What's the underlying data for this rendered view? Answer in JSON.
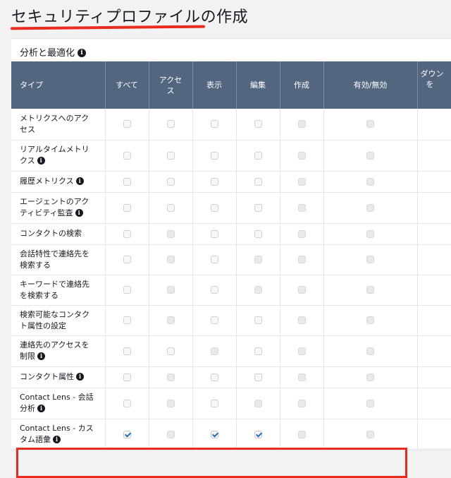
{
  "page": {
    "title": "セキュリティプロファイルの作成"
  },
  "section": {
    "title": "分析と最適化",
    "info_icon": "info-icon"
  },
  "table": {
    "columns": [
      "タイプ",
      "すべて",
      "アクセス",
      "表示",
      "編集",
      "作成",
      "有効/無効",
      "ダウン を…"
    ],
    "column_lines": {
      "access": [
        "アクセ",
        "ス"
      ],
      "download": [
        "ダウン",
        "を"
      ]
    },
    "rows": [
      {
        "label_lines": [
          "メトリクスへのアク",
          "セス"
        ],
        "info": false,
        "all": false,
        "access": false,
        "view": false,
        "edit": false,
        "create": false,
        "enable": false,
        "disabled": [
          "create",
          "enable"
        ]
      },
      {
        "label_lines": [
          "リアルタイムメトリ",
          "クス"
        ],
        "info": true,
        "all": false,
        "access": false,
        "view": false,
        "edit": false,
        "create": false,
        "enable": false,
        "disabled": [
          "create",
          "enable"
        ]
      },
      {
        "label_lines": [
          "履歴メトリクス"
        ],
        "info": true,
        "all": false,
        "access": false,
        "view": false,
        "edit": false,
        "create": false,
        "enable": false,
        "disabled": [
          "create",
          "enable"
        ]
      },
      {
        "label_lines": [
          "エージェントのアク",
          "ティビティ監査"
        ],
        "info": true,
        "all": false,
        "access": false,
        "view": false,
        "edit": false,
        "create": false,
        "enable": false,
        "disabled": [
          "create",
          "enable"
        ]
      },
      {
        "label_lines": [
          "コンタクトの検索"
        ],
        "info": false,
        "all": false,
        "access": false,
        "view": false,
        "edit": false,
        "create": false,
        "enable": false,
        "disabled": [
          "access",
          "create",
          "enable"
        ]
      },
      {
        "label_lines": [
          "会話特性で連絡先を",
          "検索する"
        ],
        "info": false,
        "all": false,
        "access": false,
        "view": false,
        "edit": false,
        "create": false,
        "enable": false,
        "disabled": [
          "access",
          "edit",
          "create",
          "enable"
        ]
      },
      {
        "label_lines": [
          "キーワードで連絡先",
          "を検索する"
        ],
        "info": false,
        "all": false,
        "access": false,
        "view": false,
        "edit": false,
        "create": false,
        "enable": false,
        "disabled": [
          "access",
          "edit",
          "create",
          "enable"
        ]
      },
      {
        "label_lines": [
          "検索可能なコンタク",
          "ト属性の設定"
        ],
        "info": false,
        "all": false,
        "access": false,
        "view": false,
        "edit": false,
        "create": false,
        "enable": false,
        "disabled": [
          "access",
          "create",
          "enable"
        ]
      },
      {
        "label_lines": [
          "連絡先のアクセスを",
          "制限"
        ],
        "info": true,
        "all": false,
        "access": false,
        "view": false,
        "edit": false,
        "create": false,
        "enable": false,
        "disabled": [
          "view",
          "create",
          "enable"
        ]
      },
      {
        "label_lines": [
          "コンタクト属性"
        ],
        "info": true,
        "all": false,
        "access": false,
        "view": false,
        "edit": false,
        "create": false,
        "enable": false,
        "disabled": [
          "access",
          "create",
          "enable"
        ]
      },
      {
        "label_lines": [
          "Contact Lens - 会話",
          "分析"
        ],
        "info": true,
        "all": false,
        "access": false,
        "view": false,
        "edit": false,
        "create": false,
        "enable": false,
        "disabled": [
          "access",
          "edit",
          "create",
          "enable"
        ]
      },
      {
        "label_lines": [
          "Contact Lens - カス",
          "タム語彙"
        ],
        "info": true,
        "all": true,
        "access": false,
        "view": true,
        "edit": true,
        "create": false,
        "enable": false,
        "disabled": [
          "access",
          "create",
          "enable"
        ]
      }
    ]
  }
}
